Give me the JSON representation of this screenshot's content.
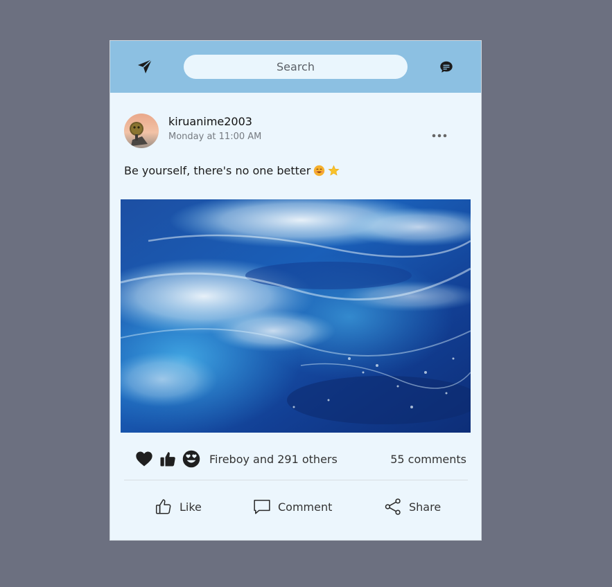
{
  "header": {
    "search_placeholder": "Search",
    "icons": [
      "send-icon",
      "chat-icon"
    ],
    "accent_color": "#8cc0e2"
  },
  "post": {
    "username": "kiruanime2003",
    "timestamp": "Monday at 11:00 AM",
    "caption": "Be yourself, there's no one better",
    "caption_emojis": [
      "smiling-face-emoji",
      "star-emoji"
    ],
    "image_description_icon": "ocean-waves-photo"
  },
  "stats": {
    "reaction_icons": [
      "heart-icon",
      "thumbs-up-icon",
      "heart-eyes-icon"
    ],
    "liked_by": "Fireboy and 291 others",
    "comments": "55 comments"
  },
  "actions": {
    "like_label": "Like",
    "comment_label": "Comment",
    "share_label": "Share"
  },
  "colors": {
    "page_background": "#6c7080",
    "card_background": "#ecf6fd",
    "header_background": "#8cc0e2"
  }
}
